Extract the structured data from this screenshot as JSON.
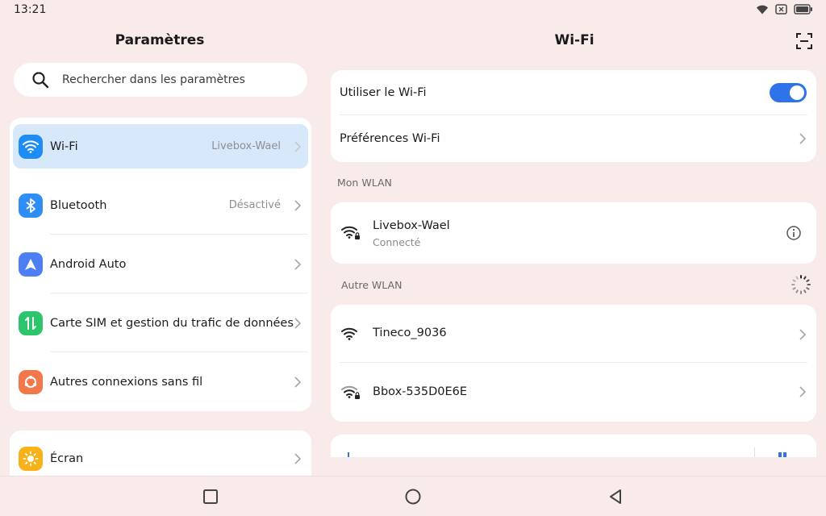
{
  "status": {
    "time": "13:21"
  },
  "left_pane": {
    "title": "Paramètres",
    "search_placeholder": "Rechercher dans les paramètres",
    "items": [
      {
        "label": "Wi-Fi",
        "value": "Livebox-Wael",
        "icon": "wifi-icon",
        "color": "#1f8cf5",
        "selected": true
      },
      {
        "label": "Bluetooth",
        "value": "Désactivé",
        "icon": "bluetooth-icon",
        "color": "#2f8ef6"
      },
      {
        "label": "Android Auto",
        "value": "",
        "icon": "android-auto-icon",
        "color": "#4d7ef4"
      },
      {
        "label": "Carte SIM et gestion du trafic de données",
        "value": "",
        "icon": "sim-data-icon",
        "color": "#2cc56b"
      },
      {
        "label": "Autres connexions sans fil",
        "value": "",
        "icon": "other-connections-icon",
        "color": "#f2784b"
      }
    ],
    "items2": [
      {
        "label": "Écran",
        "value": "",
        "icon": "display-brightness-icon",
        "color": "#f7b21a"
      }
    ]
  },
  "right_pane": {
    "title": "Wi-Fi",
    "use_wifi_label": "Utiliser le Wi-Fi",
    "wifi_enabled": true,
    "preferences_label": "Préférences Wi-Fi",
    "my_wlan_label": "Mon WLAN",
    "connected_network": {
      "name": "Livebox-Wael",
      "status": "Connecté"
    },
    "other_wlan_label": "Autre WLAN",
    "other_networks": [
      {
        "name": "Tineco_9036"
      },
      {
        "name": "Bbox-535D0E6E"
      }
    ]
  },
  "colors": {
    "background": "#f8ebea",
    "accent": "#2e73e8",
    "selected_bg": "#d7e8fb"
  }
}
